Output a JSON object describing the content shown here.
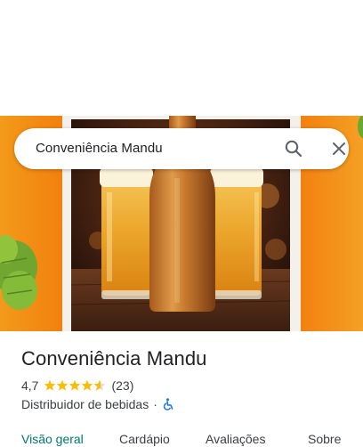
{
  "search": {
    "query": "Conveniência Mandu"
  },
  "place": {
    "name": "Conveniência Mandu",
    "rating": "4,7",
    "rating_value": 4.7,
    "review_count": "(23)",
    "category": "Distribuidor de bebidas",
    "separator": "·"
  },
  "tabs": [
    {
      "label": "Visão geral",
      "active": true
    },
    {
      "label": "Cardápio",
      "active": false
    },
    {
      "label": "Avaliações",
      "active": false
    },
    {
      "label": "Sobre",
      "active": false
    }
  ],
  "icons": {
    "search": "search-icon",
    "close": "close-icon",
    "star": "star-icon",
    "accessibility": "wheelchair-icon"
  },
  "colors": {
    "star": "#fbbc04",
    "active_tab": "#01786f",
    "accessibility": "#1a73e8",
    "hero_orange": "#f08a12"
  }
}
